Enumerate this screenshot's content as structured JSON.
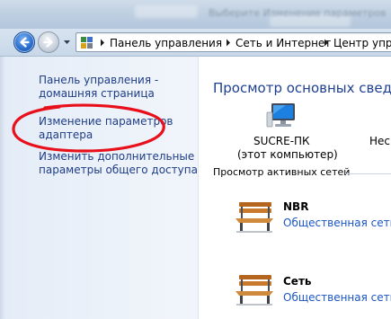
{
  "window": {
    "blurred_title": "Выберите Изменение параметров"
  },
  "address": {
    "crumbs": [
      "Панель управления",
      "Сеть и Интернет",
      "Центр управ"
    ]
  },
  "tasks": {
    "home_line1": "Панель управления -",
    "home_line2": "домашняя страница",
    "adapter_line1": "Изменение параметров",
    "adapter_line2": "адаптера",
    "sharing_line1": "Изменить дополнительные",
    "sharing_line2": "параметры общего доступа"
  },
  "main": {
    "title": "Просмотр основных сведен",
    "computer_name": "SUCRE-ПК",
    "computer_sub": "(этот компьютер)",
    "network_cut": "Неск",
    "active_networks_label": "Просмотр активных сетей"
  },
  "networks": [
    {
      "name": "NBR",
      "type": "Общественная сеть"
    },
    {
      "name": "Сеть",
      "type": "Общественная сеть"
    }
  ],
  "icons": {
    "back": "back-arrow-icon",
    "forward": "forward-arrow-icon",
    "control_panel": "control-panel-icon",
    "computer": "computer-monitor-icon",
    "public_network": "park-bench-icon"
  },
  "colors": {
    "link": "#1e3d86",
    "title": "#1e3f91",
    "network_type_link": "#1a55c4",
    "annotation": "#e8101a"
  }
}
